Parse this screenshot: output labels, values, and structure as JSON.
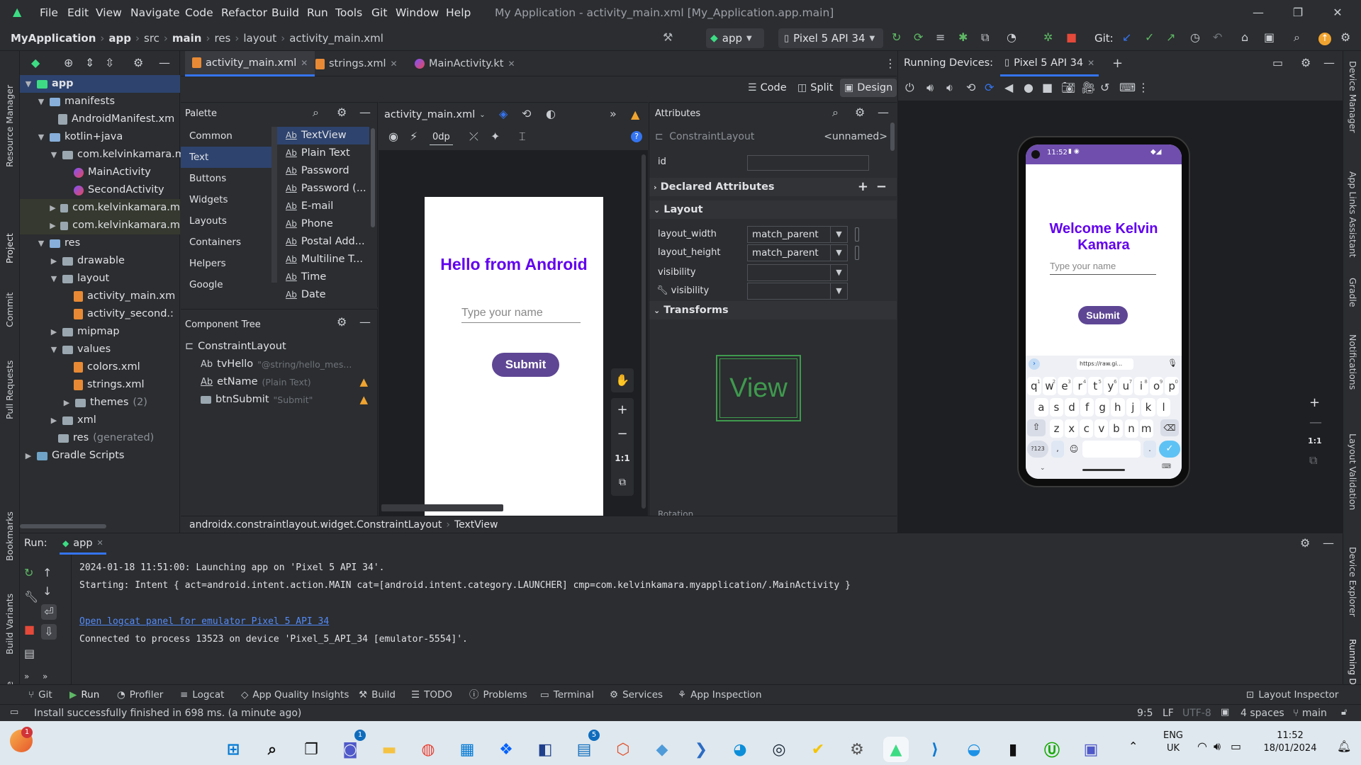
{
  "menu": [
    "File",
    "Edit",
    "View",
    "Navigate",
    "Code",
    "Refactor",
    "Build",
    "Run",
    "Tools",
    "Git",
    "Window",
    "Help"
  ],
  "window_title": "My Application - activity_main.xml [My_Application.app.main]",
  "breadcrumb": [
    "MyApplication",
    "app",
    "src",
    "main",
    "res",
    "layout",
    "activity_main.xml"
  ],
  "toolbar": {
    "run_config": "app",
    "device": "Pixel 5 API 34",
    "git_label": "Git:"
  },
  "editor_tabs": [
    "activity_main.xml",
    "strings.xml",
    "MainActivity.kt"
  ],
  "running_devices": {
    "label": "Running Devices:",
    "tab": "Pixel 5 API 34"
  },
  "view_modes": [
    "Code",
    "Split",
    "Design"
  ],
  "project_tree": [
    {
      "label": "app"
    },
    {
      "label": "manifests"
    },
    {
      "label": "AndroidManifest.xm"
    },
    {
      "label": "kotlin+java"
    },
    {
      "label": "com.kelvinkamara.m"
    },
    {
      "label": "MainActivity"
    },
    {
      "label": "SecondActivity"
    },
    {
      "label": "com.kelvinkamara.m"
    },
    {
      "label": "com.kelvinkamara.m"
    },
    {
      "label": "res"
    },
    {
      "label": "drawable"
    },
    {
      "label": "layout"
    },
    {
      "label": "activity_main.xm"
    },
    {
      "label": "activity_second.:"
    },
    {
      "label": "mipmap"
    },
    {
      "label": "values"
    },
    {
      "label": "colors.xml"
    },
    {
      "label": "strings.xml"
    },
    {
      "label": "themes",
      "suffix": "(2)"
    },
    {
      "label": "xml"
    },
    {
      "label": "res",
      "suffix": "(generated)"
    },
    {
      "label": "Gradle Scripts"
    }
  ],
  "palette": {
    "title": "Palette",
    "categories": [
      "Common",
      "Text",
      "Buttons",
      "Widgets",
      "Layouts",
      "Containers",
      "Helpers",
      "Google"
    ],
    "items": [
      "TextView",
      "Plain Text",
      "Password",
      "Password (...",
      "E-mail",
      "Phone",
      "Postal Add...",
      "Multiline T...",
      "Time",
      "Date"
    ]
  },
  "design_toolbar": {
    "file": "activity_main.xml",
    "margin": "0dp"
  },
  "component_tree": {
    "title": "Component Tree",
    "root": "ConstraintLayout",
    "items": [
      {
        "name": "tvHello",
        "hint": "\"@string/hello_mes..."
      },
      {
        "name": "etName",
        "hint": "(Plain Text)"
      },
      {
        "name": "btnSubmit",
        "hint": "\"Submit\""
      }
    ]
  },
  "preview": {
    "title": "Hello from Android",
    "hint": "Type your name",
    "button": "Submit"
  },
  "attributes": {
    "title": "Attributes",
    "class": "ConstraintLayout",
    "unnamed": "<unnamed>",
    "id_label": "id",
    "declared": "Declared Attributes",
    "layout": "Layout",
    "layout_width_label": "layout_width",
    "layout_width": "match_parent",
    "layout_height_label": "layout_height",
    "layout_height": "match_parent",
    "visibility_label": "visibility",
    "tools_visibility_label": "visibility",
    "transforms": "Transforms",
    "view_text": "View",
    "rotation": "Rotation"
  },
  "status_path": [
    "androidx.constraintlayout.widget.ConstraintLayout",
    "TextView"
  ],
  "device": {
    "time": "11:52",
    "welcome": "Welcome Kelvin Kamara",
    "hint": "Type your name",
    "button": "Submit",
    "url": "https://raw.gi...",
    "row1": [
      "q",
      "w",
      "e",
      "r",
      "t",
      "y",
      "u",
      "i",
      "o",
      "p"
    ],
    "row1_sup": [
      "1",
      "2",
      "3",
      "4",
      "5",
      "6",
      "7",
      "8",
      "9",
      "0"
    ],
    "row2": [
      "a",
      "s",
      "d",
      "f",
      "g",
      "h",
      "j",
      "k",
      "l"
    ],
    "row3": [
      "z",
      "x",
      "c",
      "v",
      "b",
      "n",
      "m"
    ],
    "sym": "?123",
    "comma": ",",
    "dot": "."
  },
  "run_panel": {
    "label": "Run:",
    "tab": "app",
    "lines": [
      "2024-01-18 11:51:00: Launching app on 'Pixel 5 API 34'.",
      "Starting: Intent { act=android.intent.action.MAIN cat=[android.intent.category.LAUNCHER] cmp=com.kelvinkamara.myapplication/.MainActivity }",
      "Open logcat panel for emulator Pixel 5 API 34",
      "Connected to process 13523 on device 'Pixel_5_API_34 [emulator-5554]'."
    ]
  },
  "bottom_tabs": [
    "Git",
    "Run",
    "Profiler",
    "Logcat",
    "App Quality Insights",
    "Build",
    "TODO",
    "Problems",
    "Terminal",
    "Services",
    "App Inspection"
  ],
  "layout_inspector": "Layout Inspector",
  "status_bar": {
    "message": "Install successfully finished in 698 ms. (a minute ago)",
    "pos": "9:5",
    "le": "LF",
    "enc": "UTF-8",
    "indent": "4 spaces",
    "branch": "main"
  },
  "left_tabs": [
    "Resource Manager",
    "Project",
    "Commit",
    "Pull Requests",
    "Bookmarks",
    "Build Variants",
    "Structure"
  ],
  "right_tabs": [
    "Device Manager",
    "App Links Assistant",
    "Gradle",
    "Notifications",
    "Layout Validation",
    "Device Explorer",
    "Running Devices"
  ],
  "taskbar": {
    "lang": "ENG",
    "region": "UK",
    "time": "11:52",
    "date": "18/01/2024",
    "notif": "1",
    "badge_teams": "1",
    "badge_app": "5"
  },
  "colors": {
    "accent": "#3574f0",
    "purple": "#6200ee",
    "button": "#5e4694",
    "device_bar": "#6f4eae"
  }
}
